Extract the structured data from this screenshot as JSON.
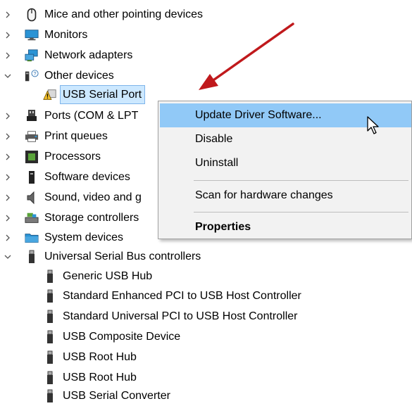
{
  "tree": {
    "items": [
      {
        "label": "Mice and other pointing devices",
        "icon": "mouse-icon",
        "state": "collapsed"
      },
      {
        "label": "Monitors",
        "icon": "monitor-icon",
        "state": "collapsed"
      },
      {
        "label": "Network adapters",
        "icon": "network-adapter-icon",
        "state": "collapsed"
      },
      {
        "label": "Other devices",
        "icon": "unknown-device-icon",
        "state": "expanded"
      },
      {
        "label": "USB Serial Port",
        "icon": "warning-device-icon",
        "state": "child-selected"
      },
      {
        "label": "Ports (COM & LPT",
        "icon": "port-icon",
        "state": "collapsed"
      },
      {
        "label": "Print queues",
        "icon": "printer-icon",
        "state": "collapsed"
      },
      {
        "label": "Processors",
        "icon": "processor-icon",
        "state": "collapsed"
      },
      {
        "label": "Software devices",
        "icon": "software-device-icon",
        "state": "collapsed"
      },
      {
        "label": "Sound, video and g",
        "icon": "speaker-icon",
        "state": "collapsed"
      },
      {
        "label": "Storage controllers",
        "icon": "storage-icon",
        "state": "collapsed"
      },
      {
        "label": "System devices",
        "icon": "folder-icon",
        "state": "collapsed"
      },
      {
        "label": "Universal Serial Bus controllers",
        "icon": "usb-icon",
        "state": "expanded"
      },
      {
        "label": "Generic USB Hub",
        "icon": "usb-icon",
        "state": "child"
      },
      {
        "label": "Standard Enhanced PCI to USB Host Controller",
        "icon": "usb-icon",
        "state": "child"
      },
      {
        "label": "Standard Universal PCI to USB Host Controller",
        "icon": "usb-icon",
        "state": "child"
      },
      {
        "label": "USB Composite Device",
        "icon": "usb-icon",
        "state": "child"
      },
      {
        "label": "USB Root Hub",
        "icon": "usb-icon",
        "state": "child"
      },
      {
        "label": "USB Root Hub",
        "icon": "usb-icon",
        "state": "child"
      },
      {
        "label": "USB Serial Converter",
        "icon": "usb-icon",
        "state": "child"
      }
    ]
  },
  "context_menu": {
    "items": [
      {
        "label": "Update Driver Software...",
        "highlighted": true
      },
      {
        "label": "Disable"
      },
      {
        "label": "Uninstall"
      },
      {
        "label": "Scan for hardware changes"
      },
      {
        "label": "Properties",
        "bold": true
      }
    ]
  },
  "colors": {
    "menu_highlight": "#91c9f7",
    "selection": "#cce8ff",
    "annotation_arrow": "#c0191c"
  }
}
